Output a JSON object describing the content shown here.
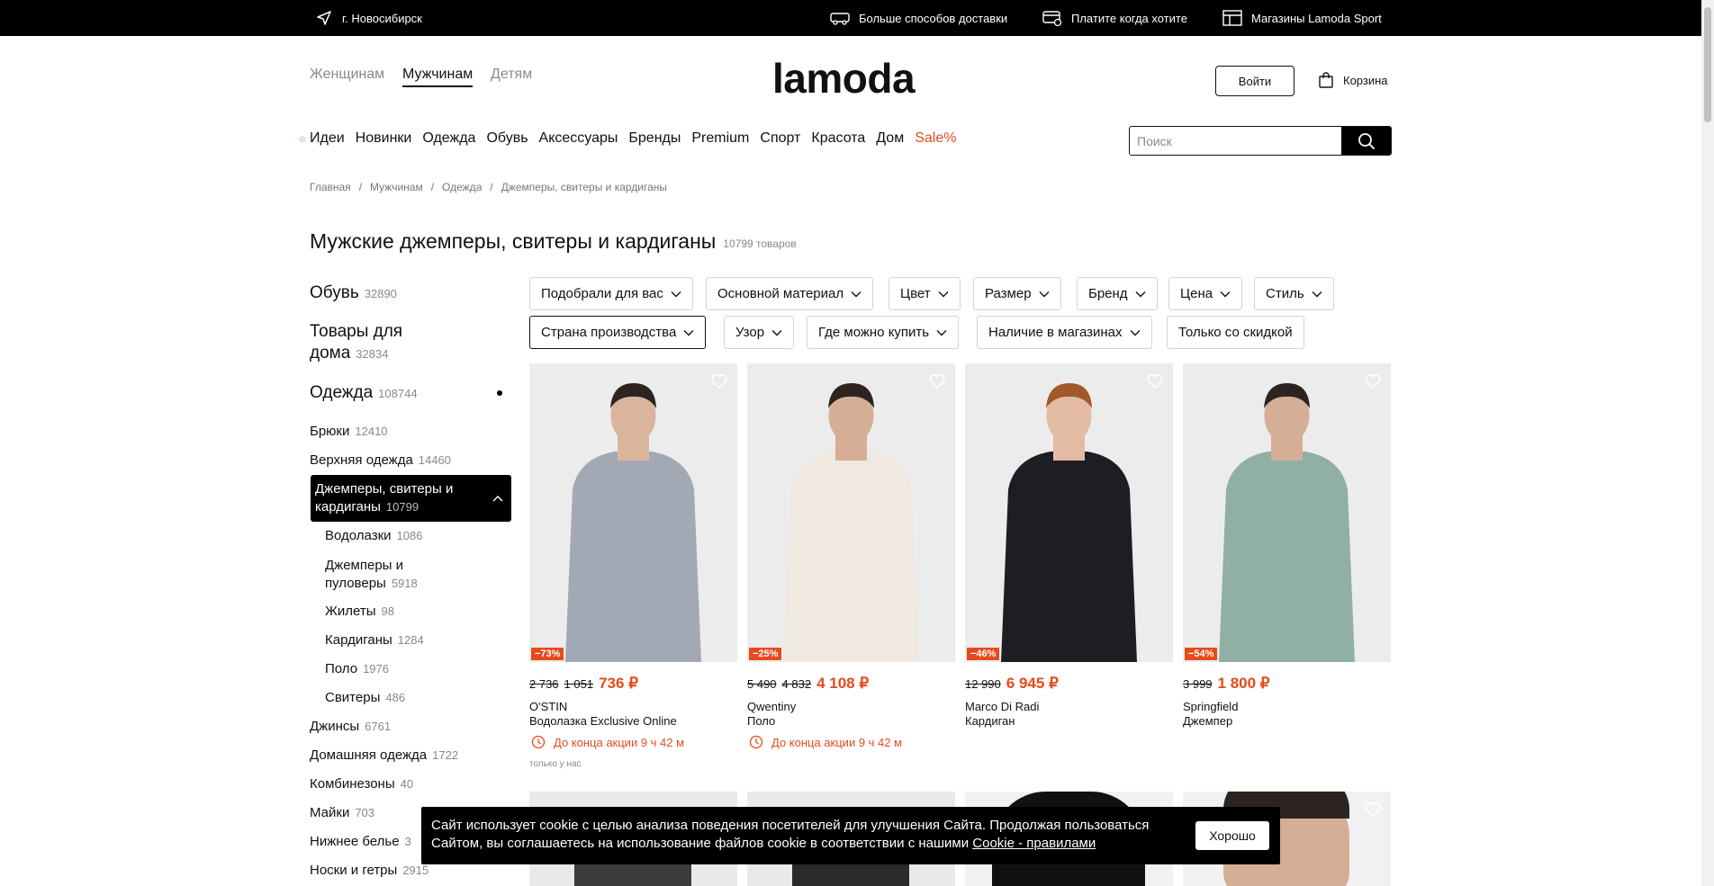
{
  "topbar": {
    "city": "г. Новосибирск",
    "delivery": "Больше способов доставки",
    "pay": "Платите когда хотите",
    "stores": "Магазины Lamoda Sport"
  },
  "header": {
    "genders": [
      "Женщинам",
      "Мужчинам",
      "Детям"
    ],
    "active_gender": "Мужчинам",
    "logo": "lamoda",
    "login": "Войти",
    "cart": "Корзина"
  },
  "nav": {
    "categories": [
      "Идеи",
      "Новинки",
      "Одежда",
      "Обувь",
      "Аксессуары",
      "Бренды",
      "Premium",
      "Спорт",
      "Красота",
      "Дом",
      "Sale%"
    ],
    "search_placeholder": "Поиск"
  },
  "breadcrumbs": [
    "Главная",
    "Мужчинам",
    "Одежда",
    "Джемперы, свитеры и кардиганы"
  ],
  "page": {
    "title": "Мужские джемперы, свитеры и кардиганы",
    "count": "10799 товаров"
  },
  "sidebar": {
    "top": [
      {
        "label": "Обувь",
        "count": "32890"
      },
      {
        "label1": "Товары для",
        "label2": "дома",
        "count": "32834"
      },
      {
        "label": "Одежда",
        "count": "108744"
      }
    ],
    "items": [
      {
        "label": "Брюки",
        "count": "12410"
      },
      {
        "label": "Верхняя одежда",
        "count": "14460"
      }
    ],
    "active": {
      "label1": "Джемперы, свитеры и",
      "label2": "кардиганы",
      "count": "10799"
    },
    "sub": [
      {
        "label": "Водолазки",
        "count": "1086"
      },
      {
        "label1": "Джемперы и",
        "label2": "пуловеры",
        "count": "5918"
      },
      {
        "label": "Жилеты",
        "count": "98"
      },
      {
        "label": "Кардиганы",
        "count": "1284"
      },
      {
        "label": "Поло",
        "count": "1976"
      },
      {
        "label": "Свитеры",
        "count": "486"
      }
    ],
    "rest": [
      {
        "label": "Джинсы",
        "count": "6761"
      },
      {
        "label": "Домашняя одежда",
        "count": "1722"
      },
      {
        "label": "Комбинезоны",
        "count": "40"
      },
      {
        "label": "Майки",
        "count": "703"
      },
      {
        "label": "Нижнее белье",
        "count": "3"
      },
      {
        "label": "Носки и гетры",
        "count": "2915"
      }
    ]
  },
  "filters": {
    "row1": [
      "Подобрали для вас",
      "Основной материал",
      "Цвет",
      "Размер",
      "Бренд",
      "Цена",
      "Стиль"
    ],
    "row2": [
      "Страна производства",
      "Узор",
      "Где можно купить",
      "Наличие в магазинах",
      "Только со скидкой"
    ]
  },
  "products": [
    {
      "discount": "−73%",
      "old1": "2 736",
      "old2": "1 051",
      "price": "736 ₽",
      "brand": "O'STIN",
      "type": "Водолазка Exclusive Online",
      "timer": "До конца акции 9 ч 42 м",
      "note": "только у нас",
      "shirt": "#a3a9b4",
      "skin": "#d9b59e",
      "pants": "#4a4a4c",
      "hair": "#2b2420"
    },
    {
      "discount": "−25%",
      "old1": "5 490",
      "old2": "4 832",
      "price": "4 108 ₽",
      "brand": "Qwentiny",
      "type": "Поло",
      "timer": "До конца акции 9 ч 42 м",
      "note": "",
      "shirt": "#efe9df",
      "skin": "#d6ae95",
      "pants": "#3e5f8a",
      "hair": "#2b2420"
    },
    {
      "discount": "−46%",
      "old1": "12 990",
      "old2": "",
      "price": "6 945 ₽",
      "brand": "Marco Di Radi",
      "type": "Кардиган",
      "timer": "",
      "note": "",
      "shirt": "#1c1e24",
      "skin": "#e3bba3",
      "pants": "#6b93bf",
      "hair": "#a0582c"
    },
    {
      "discount": "−54%",
      "old1": "3 999",
      "old2": "",
      "price": "1 800 ₽",
      "brand": "Springfield",
      "type": "Джемпер",
      "timer": "",
      "note": "",
      "shirt": "#8fb0a2",
      "skin": "#d6ae95",
      "pants": "#ecebe6",
      "hair": "#2b2420"
    }
  ],
  "cookie": {
    "text": "Сайт использует cookie с целью анализа поведения посетителей для улучшения Сайта. Продолжая пользоваться Сайтом, вы соглашаетесь на использование файлов cookie в соответствии с нашими",
    "link": "Cookie - правилами",
    "ok": "Хорошо"
  },
  "colors": {
    "accent": "#e54b1c",
    "black": "#000000"
  }
}
